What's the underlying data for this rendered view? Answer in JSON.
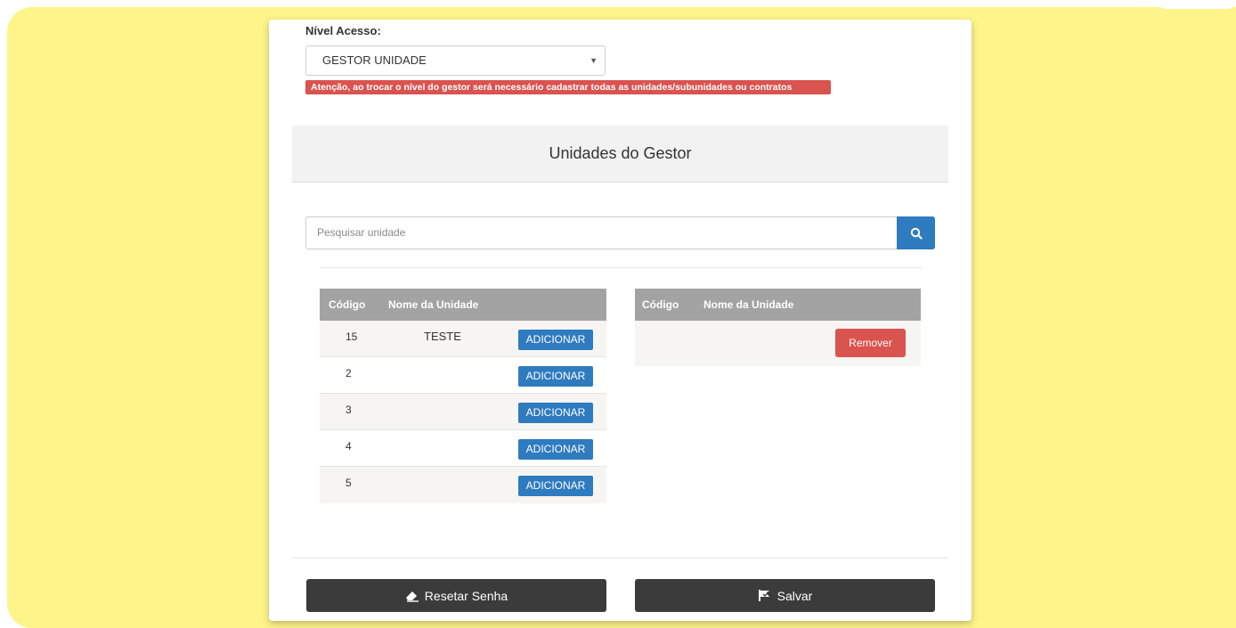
{
  "form": {
    "access_label": "Nível Acesso:",
    "access_value": "GESTOR UNIDADE",
    "warning": "Atenção, ao trocar o nível do gestor será necessário cadastrar todas as unidades/subunidades ou contratos"
  },
  "section": {
    "title": "Unidades do Gestor"
  },
  "search": {
    "placeholder": "Pesquisar unidade"
  },
  "left_table": {
    "headers": [
      "Código",
      "Nome da Unidade"
    ],
    "add_label": "ADICIONAR",
    "rows": [
      {
        "code": "15",
        "name": "TESTE"
      },
      {
        "code": "2",
        "name": ""
      },
      {
        "code": "3",
        "name": ""
      },
      {
        "code": "4",
        "name": ""
      },
      {
        "code": "5",
        "name": ""
      }
    ]
  },
  "right_table": {
    "headers": [
      "Código",
      "Nome da Unidade"
    ],
    "remove_label": "Remover"
  },
  "actions": {
    "reset_label": "Resetar Senha",
    "save_label": "Salvar"
  },
  "colors": {
    "background": "#fdf48a",
    "primary": "#2f7bc0",
    "danger": "#d9534f",
    "dark": "#3b3b3b"
  },
  "icons": {
    "select": "caret-down-icon",
    "search": "search-icon",
    "reset": "eraser-icon",
    "save": "flag-icon"
  }
}
